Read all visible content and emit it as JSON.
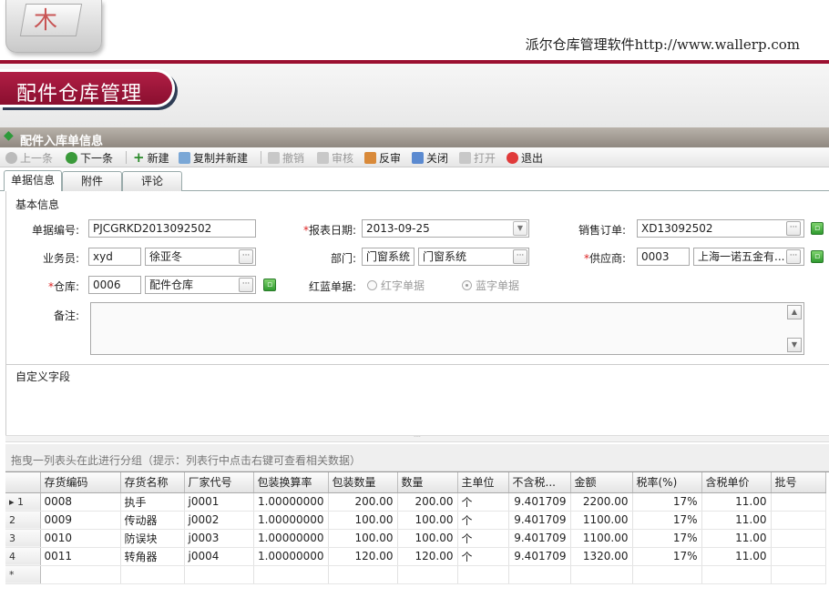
{
  "header": {
    "site_text": "派尔仓库管理软件http://www.wallerp.com",
    "logo_glyph": "木",
    "banner_title": "配件仓库管理"
  },
  "panel": {
    "title": "配件入库单信息",
    "title_icon": "leaf-icon"
  },
  "toolbar": {
    "items": [
      {
        "label": "上一条",
        "icon": "prev-icon",
        "enabled": false
      },
      {
        "label": "下一条",
        "icon": "next-icon",
        "enabled": true
      },
      {
        "label": "新建",
        "icon": "plus-icon",
        "enabled": true
      },
      {
        "label": "复制并新建",
        "icon": "copy-icon",
        "enabled": true
      },
      {
        "label": "撤销",
        "icon": "undo-icon",
        "enabled": false
      },
      {
        "label": "审核",
        "icon": "audit-icon",
        "enabled": false
      },
      {
        "label": "反审",
        "icon": "unaudit-icon",
        "enabled": true
      },
      {
        "label": "关闭",
        "icon": "close-doc-icon",
        "enabled": true
      },
      {
        "label": "打开",
        "icon": "open-doc-icon",
        "enabled": false
      },
      {
        "label": "退出",
        "icon": "exit-icon",
        "enabled": true
      }
    ]
  },
  "tabs": [
    {
      "label": "单据信息",
      "active": true
    },
    {
      "label": "附件",
      "active": false
    },
    {
      "label": "评论",
      "active": false
    }
  ],
  "form": {
    "section_basic": "基本信息",
    "doc_no_label": "单据编号:",
    "doc_no_value": "PJCGRKD2013092502",
    "report_date_label": "报表日期:",
    "report_date_value": "2013-09-25",
    "sales_order_label": "销售订单:",
    "sales_order_value": "XD13092502",
    "clerk_label": "业务员:",
    "clerk_code": "xyd",
    "clerk_name": "徐亚冬",
    "dept_label": "部门:",
    "dept_code": "门窗系统",
    "dept_name": "门窗系统",
    "supplier_label": "供应商:",
    "supplier_code": "0003",
    "supplier_name": "上海一诺五金有...",
    "warehouse_label": "仓库:",
    "warehouse_code": "0006",
    "warehouse_name": "配件仓库",
    "redblue_label": "红蓝单据:",
    "red_option": "红字单据",
    "blue_option": "蓝字单据",
    "selected_option": "蓝字单据",
    "memo_label": "备注:",
    "memo_value": "",
    "dots": "···",
    "section_custom": "自定义字段"
  },
  "group_hint": "拖曳一列表头在此进行分组（提示：列表行中点击右键可查看相关数据）",
  "grid": {
    "columns": [
      "存货编码",
      "存货名称",
      "厂家代号",
      "包装换算率",
      "包装数量",
      "数量",
      "主单位",
      "不含税...",
      "金额",
      "税率(%)",
      "含税单价",
      "批号"
    ],
    "rows": [
      {
        "idx": "1",
        "code": "0008",
        "name": "执手",
        "vendor_code": "j0001",
        "pack_rate": "1.00000000",
        "pack_qty": "200.00",
        "qty": "200.00",
        "unit": "个",
        "price_ex": "9.401709",
        "amount": "2200.00",
        "tax": "17%",
        "price_inc": "11.00",
        "batch": ""
      },
      {
        "idx": "2",
        "code": "0009",
        "name": "传动器",
        "vendor_code": "j0002",
        "pack_rate": "1.00000000",
        "pack_qty": "100.00",
        "qty": "100.00",
        "unit": "个",
        "price_ex": "9.401709",
        "amount": "1100.00",
        "tax": "17%",
        "price_inc": "11.00",
        "batch": ""
      },
      {
        "idx": "3",
        "code": "0010",
        "name": "防误块",
        "vendor_code": "j0003",
        "pack_rate": "1.00000000",
        "pack_qty": "100.00",
        "qty": "100.00",
        "unit": "个",
        "price_ex": "9.401709",
        "amount": "1100.00",
        "tax": "17%",
        "price_inc": "11.00",
        "batch": ""
      },
      {
        "idx": "4",
        "code": "0011",
        "name": "转角器",
        "vendor_code": "j0004",
        "pack_rate": "1.00000000",
        "pack_qty": "120.00",
        "qty": "120.00",
        "unit": "个",
        "price_ex": "9.401709",
        "amount": "1320.00",
        "tax": "17%",
        "price_inc": "11.00",
        "batch": ""
      }
    ],
    "new_row_marker": "*"
  }
}
